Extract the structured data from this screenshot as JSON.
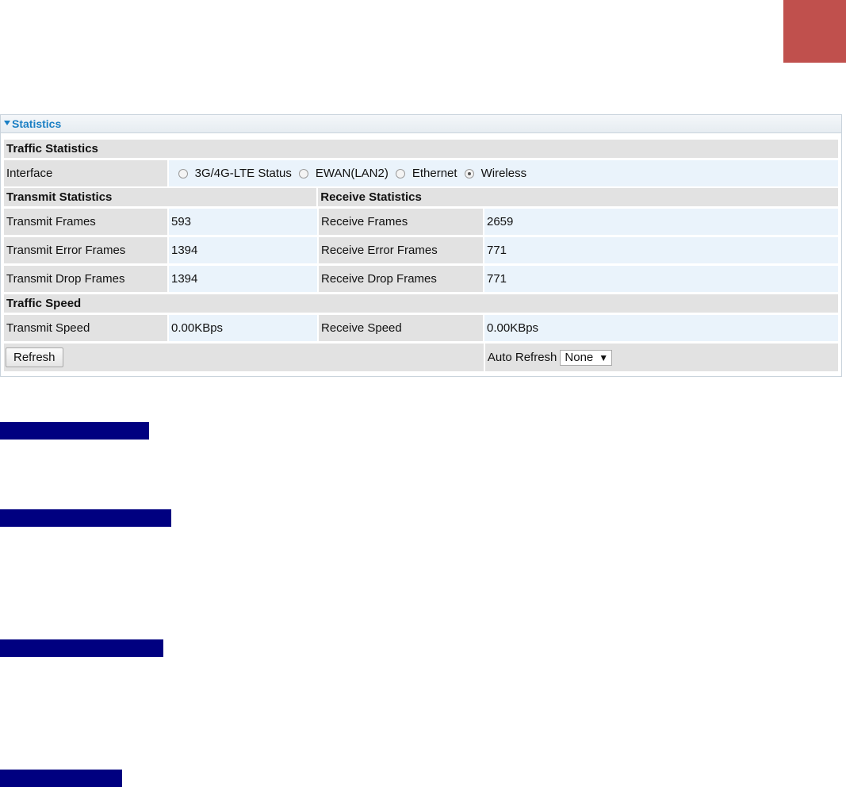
{
  "panel": {
    "title": "Statistics"
  },
  "traffic_statistics": {
    "heading": "Traffic Statistics",
    "interface_label": "Interface",
    "interfaces": [
      {
        "label": "3G/4G-LTE Status",
        "checked": false
      },
      {
        "label": "EWAN(LAN2)",
        "checked": false
      },
      {
        "label": "Ethernet",
        "checked": false
      },
      {
        "label": "Wireless",
        "checked": true
      }
    ]
  },
  "transmit": {
    "heading": "Transmit Statistics",
    "rows": [
      {
        "label": "Transmit Frames",
        "value": "593"
      },
      {
        "label": "Transmit Error Frames",
        "value": "1394"
      },
      {
        "label": "Transmit Drop Frames",
        "value": "1394"
      }
    ]
  },
  "receive": {
    "heading": "Receive Statistics",
    "rows": [
      {
        "label": "Receive Frames",
        "value": "2659"
      },
      {
        "label": "Receive Error Frames",
        "value": "771"
      },
      {
        "label": "Receive Drop Frames",
        "value": "771"
      }
    ]
  },
  "traffic_speed": {
    "heading": "Traffic Speed",
    "transmit_label": "Transmit Speed",
    "transmit_value": "0.00KBps",
    "receive_label": "Receive Speed",
    "receive_value": "0.00KBps"
  },
  "controls": {
    "refresh_label": "Refresh",
    "auto_refresh_label": "Auto Refresh",
    "auto_refresh_value": "None"
  },
  "colors": {
    "corner_block": "#c0504d",
    "highlight_bar": "#000080",
    "accent": "#1a7fc4"
  }
}
